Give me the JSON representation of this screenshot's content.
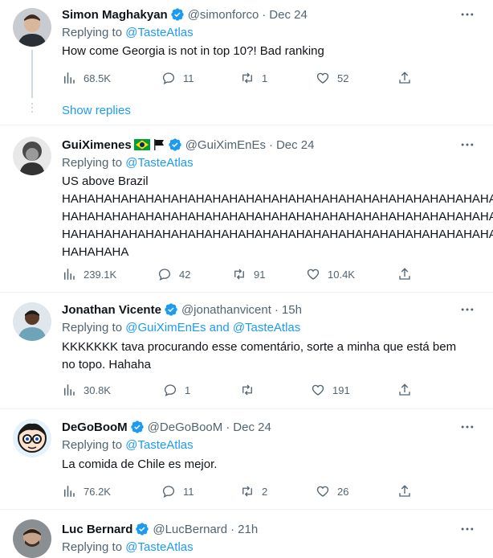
{
  "tweets": [
    {
      "name": "Simon Maghakyan",
      "handle": "@simonforco",
      "time": "Dec 24",
      "replying_prefix": "Replying to",
      "replying_to": "@TasteAtlas",
      "text": "How come Georgia is not in top 10?! Bad ranking",
      "views": "68.5K",
      "replies": "11",
      "retweets": "1",
      "likes": "52"
    },
    {
      "name": "GuiXimenes",
      "handle": "@GuiXimEnEs",
      "time": "Dec 24",
      "replying_prefix": "Replying to",
      "replying_to": "@TasteAtlas",
      "text_lines": [
        "US above Brazil",
        "HAHAHAHAHAHAHAHAHAHAHAHAHAHAHAHAHAHAHAHAHAHAHAHAHAHA",
        "HAHAHAHAHAHAHAHAHAHAHAHAHAHAHAHAHAHAHAHAHAHAHAHAHAHA",
        "HAHAHAHAHAHAHAHAHAHAHAHAHAHAHAHAHAHAHAHAHAHAHAHAHAHA",
        "HAHAHAHA"
      ],
      "views": "239.1K",
      "replies": "42",
      "retweets": "91",
      "likes": "10.4K"
    },
    {
      "name": "Jonathan Vicente",
      "handle": "@jonathanvicent",
      "time": "15h",
      "replying_prefix": "Replying to",
      "replying_to": "@GuiXimEnEs and @TasteAtlas",
      "text_lines": [
        "KKKKKKK tava procurando esse comentário, sorte a minha que está bem",
        "no topo. Hahaha"
      ],
      "views": "30.8K",
      "replies": "1",
      "retweets": "",
      "likes": "191"
    },
    {
      "name": "DeGoBooM",
      "handle": "@DeGoBooM",
      "time": "Dec 24",
      "replying_prefix": "Replying to",
      "replying_to": "@TasteAtlas",
      "text": "La comida de Chile es mejor.",
      "views": "76.2K",
      "replies": "11",
      "retweets": "2",
      "likes": "26"
    },
    {
      "name": "Luc Bernard",
      "handle": "@LucBernard",
      "time": "21h",
      "replying_prefix": "Replying to",
      "replying_to": "@TasteAtlas"
    }
  ],
  "show_replies": "Show replies",
  "separator": "·",
  "colors": {
    "link": "#1d9bf0",
    "muted": "#536471",
    "text": "#0f1419",
    "border": "#eff3f4"
  }
}
